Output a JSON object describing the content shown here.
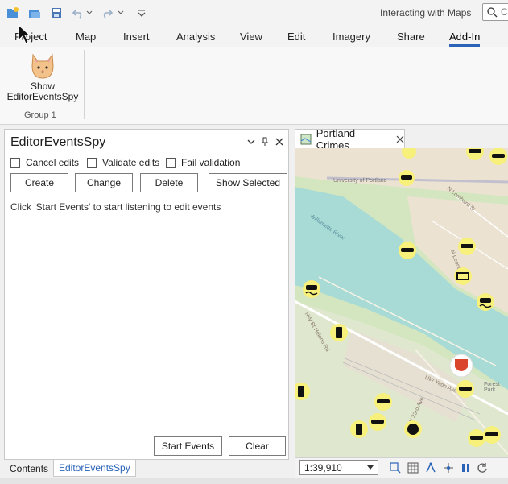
{
  "qat": {
    "app_title": "Interacting with Maps",
    "search_placeholder": "C",
    "icons": [
      "new-project-icon",
      "open-project-icon",
      "save-project-icon",
      "undo-icon",
      "redo-icon",
      "customize-qat-icon",
      "command-search-icon"
    ]
  },
  "ribbon_tabs": [
    "Project",
    "Map",
    "Insert",
    "Analysis",
    "View",
    "Edit",
    "Imagery",
    "Share",
    "Add-In"
  ],
  "active_tab": "Add-In",
  "ribbon": {
    "button_line1": "Show",
    "button_line2": "EditorEventsSpy",
    "group_label": "Group 1"
  },
  "pane": {
    "title": "EditorEventsSpy",
    "checkboxes": [
      "Cancel edits",
      "Validate edits",
      "Fail validation"
    ],
    "buttons": {
      "create": "Create",
      "change": "Change",
      "delete": "Delete",
      "show_selected": "Show Selected"
    },
    "hint": "Click 'Start Events' to start listening to edit events",
    "start_events": "Start Events",
    "clear": "Clear"
  },
  "bottom_tabs": {
    "contents": "Contents",
    "spy": "EditorEventsSpy"
  },
  "map": {
    "tab_title": "Portland Crimes",
    "scale": "1:39,910",
    "labels": [
      "University of Portland",
      "Willamette River",
      "N Lombard St",
      "N Leonard Ave",
      "NW Yeon Ave",
      "NW 23rd Ave",
      "NW St Helens Rd",
      "Forest Park"
    ],
    "colors": {
      "water": "#a8dbd5",
      "land": "#d4e6c0",
      "industrial": "#ebe2d2",
      "symbol": "#f7f07a",
      "accent": "#2a63b8"
    }
  }
}
